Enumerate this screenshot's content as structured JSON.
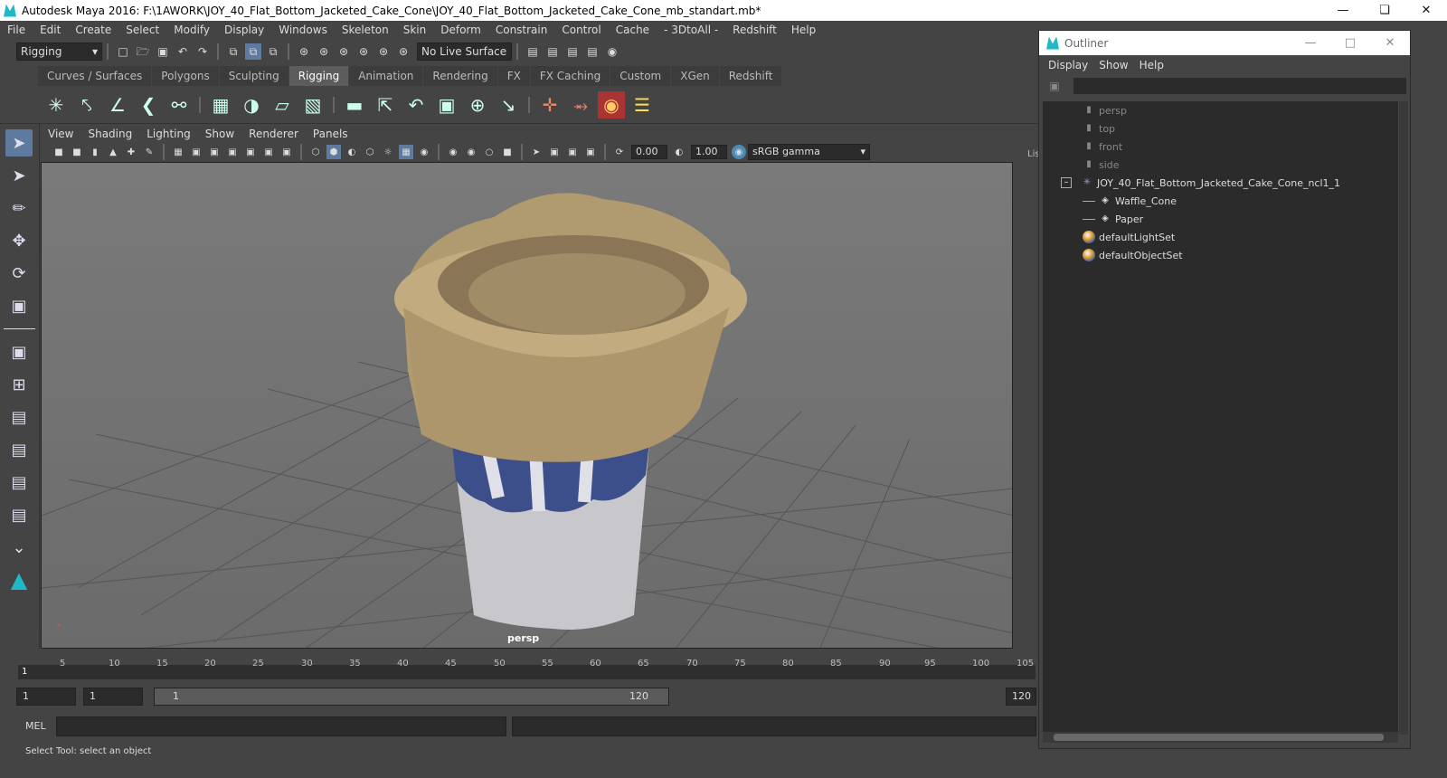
{
  "window": {
    "title": "Autodesk Maya 2016: F:\\1AWORK\\JOY_40_Flat_Bottom_Jacketed_Cake_Cone\\JOY_40_Flat_Bottom_Jacketed_Cake_Cone_mb_standart.mb*"
  },
  "menu": [
    "File",
    "Edit",
    "Create",
    "Select",
    "Modify",
    "Display",
    "Windows",
    "Skeleton",
    "Skin",
    "Deform",
    "Constrain",
    "Control",
    "Cache",
    "- 3DtoAll -",
    "Redshift",
    "Help"
  ],
  "module_dropdown": "Rigging",
  "live_surface": "No Live Surface",
  "shelf_tabs": [
    {
      "label": "Curves / Surfaces",
      "active": false
    },
    {
      "label": "Polygons",
      "active": false
    },
    {
      "label": "Sculpting",
      "active": false
    },
    {
      "label": "Rigging",
      "active": true
    },
    {
      "label": "Animation",
      "active": false
    },
    {
      "label": "Rendering",
      "active": false
    },
    {
      "label": "FX",
      "active": false
    },
    {
      "label": "FX Caching",
      "active": false
    },
    {
      "label": "Custom",
      "active": false
    },
    {
      "label": "XGen",
      "active": false
    },
    {
      "label": "Redshift",
      "active": false
    }
  ],
  "panel_menu": [
    "View",
    "Shading",
    "Lighting",
    "Show",
    "Renderer",
    "Panels"
  ],
  "viewport": {
    "exposure": "0.00",
    "gamma": "1.00",
    "color_space": "sRGB gamma",
    "camera": "persp"
  },
  "timeline": {
    "ticks": [
      "5",
      "10",
      "15",
      "20",
      "25",
      "30",
      "35",
      "40",
      "45",
      "50",
      "55",
      "60",
      "65",
      "70",
      "75",
      "80",
      "85",
      "90",
      "95",
      "100",
      "105"
    ],
    "current": "1"
  },
  "range": {
    "start": "1",
    "current": "1",
    "range_start": "1",
    "range_end": "120",
    "end": "120"
  },
  "mel_label": "MEL",
  "status": "Select Tool: select an object",
  "outliner": {
    "title": "Outliner",
    "menu": [
      "Display",
      "Show",
      "Help"
    ],
    "items": [
      {
        "label": "persp",
        "kind": "camera"
      },
      {
        "label": "top",
        "kind": "camera"
      },
      {
        "label": "front",
        "kind": "camera"
      },
      {
        "label": "side",
        "kind": "camera"
      },
      {
        "label": "JOY_40_Flat_Bottom_Jacketed_Cake_Cone_ncl1_1",
        "kind": "group"
      },
      {
        "label": "Waffle_Cone",
        "kind": "mesh"
      },
      {
        "label": "Paper",
        "kind": "mesh"
      },
      {
        "label": "defaultLightSet",
        "kind": "set"
      },
      {
        "label": "defaultObjectSet",
        "kind": "set"
      }
    ]
  },
  "side_label": "Lis"
}
